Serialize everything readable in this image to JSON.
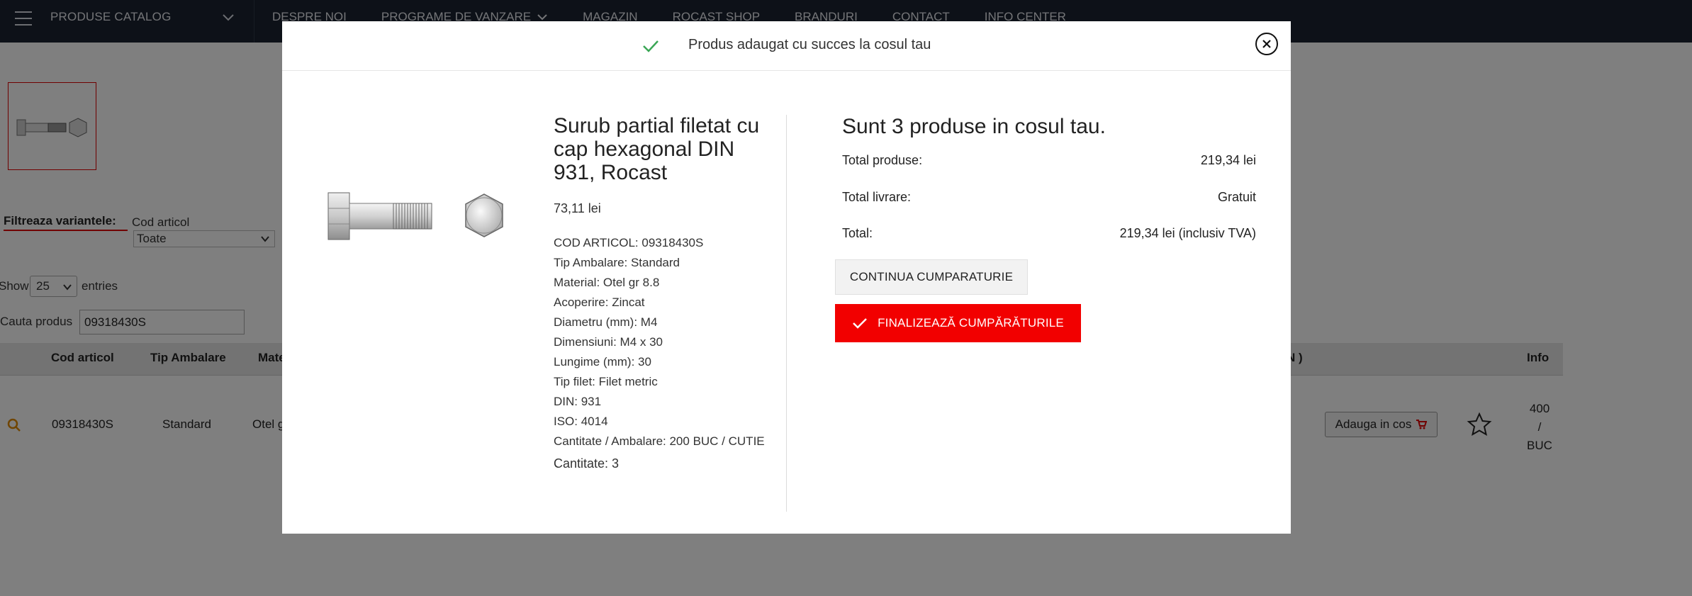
{
  "nav": {
    "catalog_label": "PRODUSE CATALOG",
    "links": [
      "DESPRE NOI",
      "PROGRAME DE VANZARE",
      "MAGAZIN",
      "ROCAST SHOP",
      "BRANDURI",
      "CONTACT",
      "INFO CENTER"
    ]
  },
  "filter": {
    "label": "Filtreaza variantele:",
    "column_label": "Cod articol",
    "selected": "Toate"
  },
  "table_controls": {
    "show_label": "Show",
    "entries_value": "25",
    "entries_label": "entries",
    "search_label": "Cauta produs",
    "search_value": "09318430S"
  },
  "table": {
    "headers": [
      "Cod articol",
      "Tip Ambalare",
      "Mate",
      "N )",
      "Info"
    ],
    "row": {
      "cod": "09318430S",
      "ambalare": "Standard",
      "material": "Otel g",
      "add_button": "Adauga in cos",
      "info_line1": "400",
      "info_line2": "/",
      "info_line3": "BUC"
    }
  },
  "modal": {
    "success_message": "Produs adaugat cu succes la cosul tau",
    "product_title": "Surub partial filetat cu cap hexagonal DIN 931, Rocast",
    "price": "73,11 lei",
    "specs": [
      "COD ARTICOL: 09318430S",
      "Tip Ambalare: Standard",
      "Material: Otel gr 8.8",
      "Acoperire: Zincat",
      "Diametru (mm): M4",
      "Dimensiuni: M4 x 30",
      "Lungime (mm): 30",
      "Tip filet: Filet metric",
      "DIN: 931",
      "ISO: 4014",
      "Cantitate / Ambalare: 200 BUC / CUTIE"
    ],
    "quantity": "Cantitate: 3",
    "cart_title": "Sunt 3 produse in cosul tau.",
    "summary": {
      "total_products_label": "Total produse:",
      "total_products_value": "219,34 lei",
      "delivery_label": "Total livrare:",
      "delivery_value": "Gratuit",
      "total_label": "Total:",
      "total_value": "219,34 lei (inclusiv TVA)"
    },
    "continue_button": "CONTINUA CUMPARATURIE",
    "finalize_button": "FINALIZEAZĂ CUMPĂRĂTURILE"
  },
  "colors": {
    "nav_bg": "#1b2330",
    "accent_red": "#f20000",
    "success_green": "#3aa655"
  },
  "icons": [
    "menu-icon",
    "chevron-down-icon",
    "search-icon",
    "cart-icon",
    "star-icon",
    "check-icon",
    "close-icon"
  ]
}
